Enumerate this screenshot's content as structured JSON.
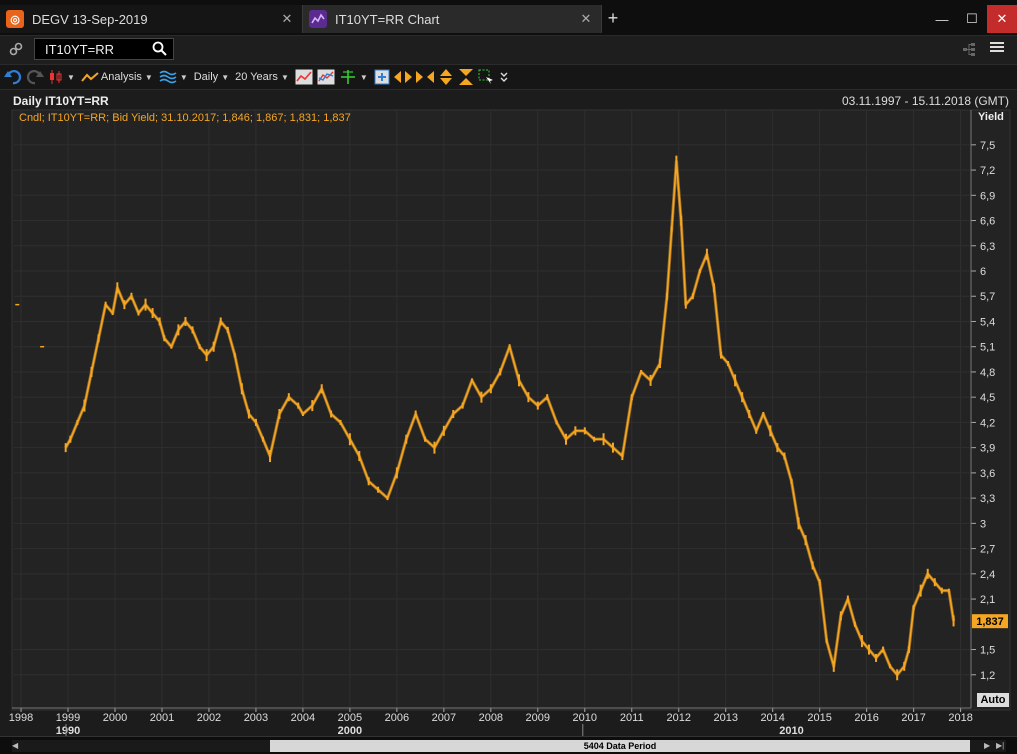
{
  "tabs": [
    {
      "label": "DEGV 13-Sep-2019",
      "icon": "degv-app-icon",
      "active": false
    },
    {
      "label": "IT10YT=RR Chart",
      "icon": "chart-app-icon",
      "active": true
    }
  ],
  "search": {
    "value": "IT10YT=RR",
    "placeholder": ""
  },
  "toolbar": {
    "analysis_label": "Analysis",
    "interval_label": "Daily",
    "period_label": "20 Years"
  },
  "chart_header": {
    "title": "Daily IT10YT=RR",
    "date_range": "03.11.1997 - 15.11.2018 (GMT)"
  },
  "legend_text": "Cndl; IT10YT=RR; Bid Yield; 31.10.2017; 1,846; 1,867; 1,831; 1,837",
  "auto_label": "Auto",
  "scroll_label": "5404 Data Period",
  "colors": {
    "series": "#f5a623",
    "background": "#232323",
    "grid": "#2f2f2f",
    "last_value_tag": "#f5a623"
  },
  "chart_data": {
    "type": "line",
    "series_style": "candlestick",
    "ylabel": "Yield",
    "y_ticks": [
      "7,5",
      "7,2",
      "6,9",
      "6,6",
      "6,3",
      "6",
      "5,7",
      "5,4",
      "5,1",
      "4,8",
      "4,5",
      "4,2",
      "3,9",
      "3,6",
      "3,3",
      "3",
      "2,7",
      "2,4",
      "2,1",
      "1,5",
      "1,2"
    ],
    "y_tick_values": [
      7.5,
      7.2,
      6.9,
      6.6,
      6.3,
      6.0,
      5.7,
      5.4,
      5.1,
      4.8,
      4.5,
      4.2,
      3.9,
      3.6,
      3.3,
      3.0,
      2.7,
      2.4,
      2.1,
      1.5,
      1.2
    ],
    "ylim": [
      0.9,
      7.7
    ],
    "x_ticks": [
      "1998",
      "1999",
      "2000",
      "2001",
      "2002",
      "2003",
      "2004",
      "2005",
      "2006",
      "2007",
      "2008",
      "2009",
      "2010",
      "2011",
      "2012",
      "2013",
      "2014",
      "2015",
      "2016",
      "2017",
      "2018"
    ],
    "x_tick_values": [
      1998,
      1999,
      2000,
      2001,
      2002,
      2003,
      2004,
      2005,
      2006,
      2007,
      2008,
      2009,
      2010,
      2011,
      2012,
      2013,
      2014,
      2015,
      2016,
      2017,
      2018
    ],
    "decade_labels": [
      "1990",
      "2000",
      "2010"
    ],
    "decade_values": [
      1999,
      2005,
      2014.4
    ],
    "xlim": [
      1997.85,
      2018.2
    ],
    "last_value": "1,837",
    "last_value_num": 1.837,
    "x": [
      1997.92,
      1998.45,
      1998.95,
      1999.05,
      1999.2,
      1999.35,
      1999.5,
      1999.65,
      1999.8,
      1999.95,
      2000.05,
      2000.2,
      2000.35,
      2000.5,
      2000.65,
      2000.8,
      2000.95,
      2001.05,
      2001.2,
      2001.35,
      2001.5,
      2001.65,
      2001.8,
      2001.95,
      2002.1,
      2002.25,
      2002.4,
      2002.55,
      2002.7,
      2002.85,
      2003.0,
      2003.15,
      2003.3,
      2003.5,
      2003.7,
      2003.9,
      2004.0,
      2004.2,
      2004.4,
      2004.6,
      2004.8,
      2005.0,
      2005.2,
      2005.4,
      2005.6,
      2005.8,
      2006.0,
      2006.2,
      2006.4,
      2006.6,
      2006.8,
      2007.0,
      2007.2,
      2007.4,
      2007.6,
      2007.8,
      2008.0,
      2008.2,
      2008.4,
      2008.6,
      2008.8,
      2009.0,
      2009.2,
      2009.4,
      2009.6,
      2009.8,
      2010.0,
      2010.2,
      2010.4,
      2010.6,
      2010.8,
      2011.0,
      2011.2,
      2011.4,
      2011.6,
      2011.75,
      2011.85,
      2011.95,
      2012.05,
      2012.15,
      2012.3,
      2012.45,
      2012.6,
      2012.75,
      2012.9,
      2013.05,
      2013.2,
      2013.35,
      2013.5,
      2013.65,
      2013.8,
      2013.95,
      2014.1,
      2014.25,
      2014.4,
      2014.55,
      2014.7,
      2014.85,
      2015.0,
      2015.15,
      2015.3,
      2015.45,
      2015.6,
      2015.75,
      2015.9,
      2016.05,
      2016.2,
      2016.35,
      2016.5,
      2016.65,
      2016.8,
      2016.9,
      2017.0,
      2017.15,
      2017.3,
      2017.45,
      2017.6,
      2017.75,
      2017.85
    ],
    "values": [
      5.6,
      5.1,
      3.9,
      4.0,
      4.2,
      4.4,
      4.8,
      5.2,
      5.6,
      5.5,
      5.8,
      5.6,
      5.7,
      5.5,
      5.6,
      5.5,
      5.4,
      5.2,
      5.1,
      5.3,
      5.4,
      5.3,
      5.1,
      5.0,
      5.1,
      5.4,
      5.3,
      5.0,
      4.6,
      4.3,
      4.2,
      4.0,
      3.8,
      4.3,
      4.5,
      4.4,
      4.3,
      4.4,
      4.6,
      4.3,
      4.2,
      4.0,
      3.8,
      3.5,
      3.4,
      3.3,
      3.6,
      4.0,
      4.3,
      4.0,
      3.9,
      4.1,
      4.3,
      4.4,
      4.7,
      4.5,
      4.6,
      4.8,
      5.1,
      4.7,
      4.5,
      4.4,
      4.5,
      4.2,
      4.0,
      4.1,
      4.1,
      4.0,
      4.0,
      3.9,
      3.8,
      4.5,
      4.8,
      4.7,
      4.9,
      5.7,
      6.5,
      7.3,
      6.6,
      5.6,
      5.7,
      6.0,
      6.2,
      5.8,
      5.0,
      4.9,
      4.7,
      4.5,
      4.3,
      4.1,
      4.3,
      4.1,
      3.9,
      3.8,
      3.5,
      3.0,
      2.8,
      2.5,
      2.3,
      1.6,
      1.3,
      1.9,
      2.1,
      1.8,
      1.6,
      1.5,
      1.4,
      1.5,
      1.3,
      1.2,
      1.3,
      1.5,
      2.0,
      2.2,
      2.4,
      2.3,
      2.2,
      2.2,
      1.84
    ]
  }
}
